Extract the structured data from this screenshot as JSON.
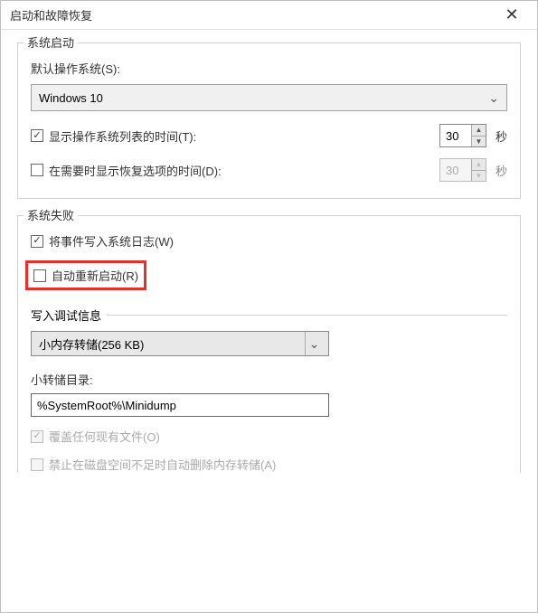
{
  "title": "启动和故障恢复",
  "startup": {
    "legend": "系统启动",
    "default_os_label": "默认操作系统(S):",
    "default_os_value": "Windows 10",
    "show_list_checkbox": {
      "checked": true,
      "label": "显示操作系统列表的时间(T):",
      "value": "30",
      "unit": "秒"
    },
    "show_recovery_checkbox": {
      "checked": false,
      "label": "在需要时显示恢复选项的时间(D):",
      "value": "30",
      "unit": "秒"
    }
  },
  "failure": {
    "legend": "系统失败",
    "write_event": {
      "checked": true,
      "label": "将事件写入系统日志(W)"
    },
    "auto_restart": {
      "checked": false,
      "label": "自动重新启动(R)"
    },
    "debug_info": {
      "legend": "写入调试信息",
      "dump_type": "小内存转储(256 KB)",
      "directory_label": "小转储目录:",
      "directory_value": "%SystemRoot%\\Minidump",
      "overwrite": {
        "checked": true,
        "label": "覆盖任何现有文件(O)"
      },
      "disable_on_low_disk": {
        "checked": false,
        "label": "禁止在磁盘空间不足时自动删除内存转储(A)"
      }
    }
  }
}
